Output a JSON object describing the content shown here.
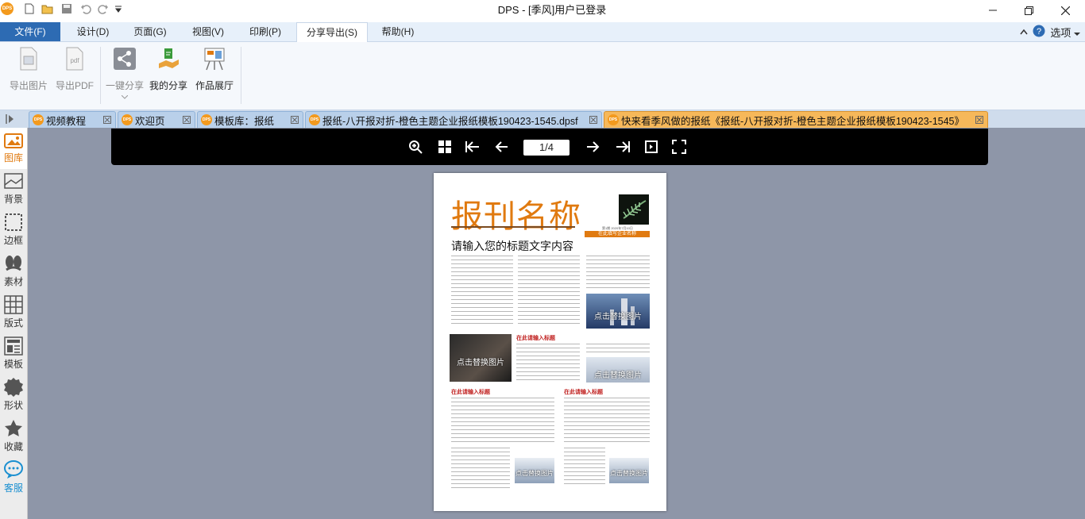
{
  "app": {
    "logo_text": "DPS",
    "title": "DPS - [季风]用户已登录"
  },
  "menu": {
    "tabs": [
      "文件(F)",
      "设计(D)",
      "页面(G)",
      "视图(V)",
      "印刷(P)",
      "分享导出(S)",
      "帮助(H)"
    ],
    "active_tab": "分享导出(S)",
    "options_label": "选项"
  },
  "ribbon": {
    "buttons": [
      "导出图片",
      "导出PDF",
      "一键分享",
      "我的分享",
      "作品展厅"
    ],
    "pdf_icon_text": "pdf"
  },
  "doc_tabs": {
    "items": [
      "视频教程",
      "欢迎页",
      "模板库：报纸",
      "报纸-八开报对折-橙色主题企业报纸模板190423-1545.dpsf",
      "快来看季风做的报纸《报纸-八开报对折-橙色主题企业报纸模板190423-1545》"
    ],
    "active_index": 4
  },
  "left_panel": {
    "items": [
      "图库",
      "背景",
      "边框",
      "素材",
      "版式",
      "模板",
      "形状",
      "收藏",
      "客服"
    ],
    "active": "图库"
  },
  "viewer": {
    "page_indicator": "1/4"
  },
  "newspaper": {
    "masthead": "报刊名称",
    "issue_line": "第1期   2020年7月10日",
    "ribbon_text": "在此填写企业名称",
    "headline": "请输入您的标题文字内容",
    "section_heading": "在此请输入标题",
    "photo_placeholder": "点击替换图片"
  },
  "colors": {
    "accent": "#e07a10",
    "menu_active": "#2d6bb3",
    "active_tab": "#f6b85a",
    "workspace": "#8e96a8"
  }
}
